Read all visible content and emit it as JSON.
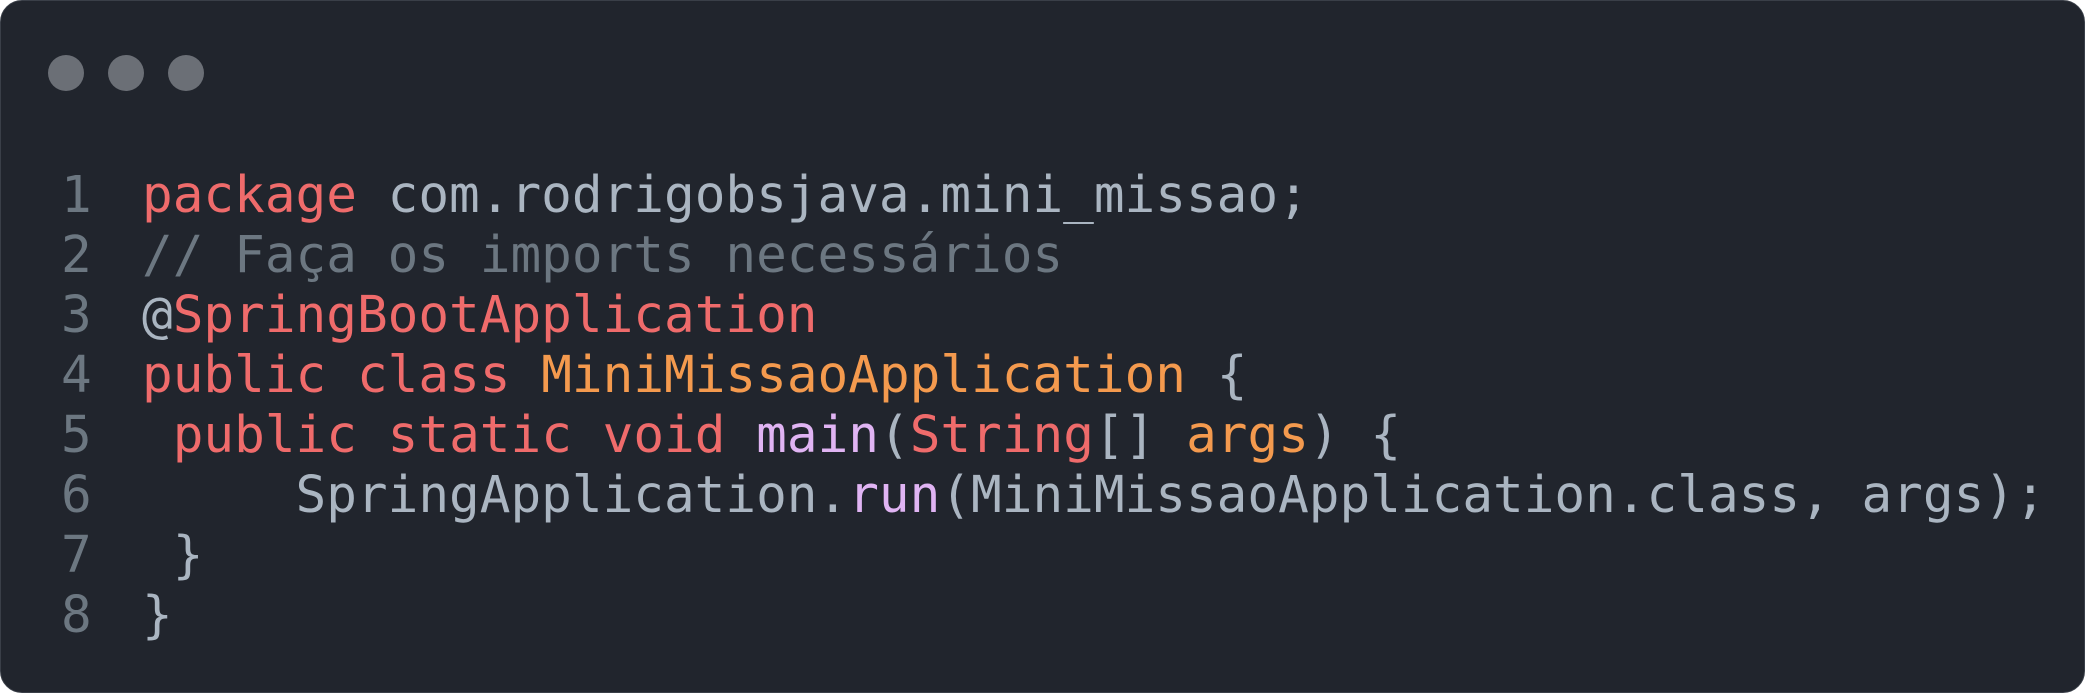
{
  "window": {
    "controls": [
      {
        "name": "close",
        "color": "#6b6f76"
      },
      {
        "name": "minimize",
        "color": "#6b6f76"
      },
      {
        "name": "maximize",
        "color": "#6b6f76"
      }
    ]
  },
  "theme": {
    "background": "#21252d",
    "keyword": "#ef6b6b",
    "type": "#f49a4e",
    "method": "#e0b4f3",
    "comment": "#6c7781",
    "text": "#aab5c1",
    "line_number": "#6c7781"
  },
  "code": {
    "lines": [
      {
        "number": "1",
        "tokens": [
          {
            "text": "package",
            "kind": "keyword"
          },
          {
            "text": " com.rodrigobsjava.mini_missao;",
            "kind": "text"
          }
        ]
      },
      {
        "number": "2",
        "tokens": [
          {
            "text": "// Faça os imports necessários",
            "kind": "comment"
          }
        ]
      },
      {
        "number": "3",
        "tokens": [
          {
            "text": "@",
            "kind": "text"
          },
          {
            "text": "SpringBootApplication",
            "kind": "keyword"
          }
        ]
      },
      {
        "number": "4",
        "tokens": [
          {
            "text": "public",
            "kind": "keyword"
          },
          {
            "text": " ",
            "kind": "text"
          },
          {
            "text": "class",
            "kind": "keyword"
          },
          {
            "text": " ",
            "kind": "text"
          },
          {
            "text": "MiniMissaoApplication",
            "kind": "type"
          },
          {
            "text": " {",
            "kind": "text"
          }
        ]
      },
      {
        "number": "5",
        "tokens": [
          {
            "text": " ",
            "kind": "text"
          },
          {
            "text": "public",
            "kind": "keyword"
          },
          {
            "text": " ",
            "kind": "text"
          },
          {
            "text": "static",
            "kind": "keyword"
          },
          {
            "text": " ",
            "kind": "text"
          },
          {
            "text": "void",
            "kind": "keyword"
          },
          {
            "text": " ",
            "kind": "text"
          },
          {
            "text": "main",
            "kind": "method"
          },
          {
            "text": "(",
            "kind": "text"
          },
          {
            "text": "String",
            "kind": "keyword"
          },
          {
            "text": "[] ",
            "kind": "text"
          },
          {
            "text": "args",
            "kind": "type"
          },
          {
            "text": ") {",
            "kind": "text"
          }
        ]
      },
      {
        "number": "6",
        "tokens": [
          {
            "text": "     SpringApplication.",
            "kind": "text"
          },
          {
            "text": "run",
            "kind": "method"
          },
          {
            "text": "(MiniMissaoApplication.class, args);",
            "kind": "text"
          }
        ]
      },
      {
        "number": "7",
        "tokens": [
          {
            "text": " }",
            "kind": "text"
          }
        ]
      },
      {
        "number": "8",
        "tokens": [
          {
            "text": "}",
            "kind": "text"
          }
        ]
      }
    ]
  }
}
